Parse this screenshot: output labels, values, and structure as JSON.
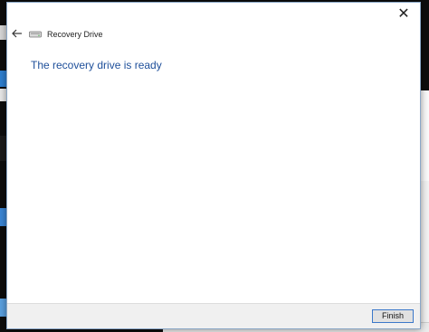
{
  "dialog": {
    "title": "Recovery Drive",
    "heading": "The recovery drive is ready",
    "close_label": "✕",
    "finish_label": "Finish"
  },
  "icons": {
    "back": "back-arrow-icon",
    "close": "close-icon",
    "drive": "drive-icon"
  },
  "colors": {
    "heading": "#1e4f9a",
    "button_border": "#3b78c9",
    "footer_bg": "#f0f0f0"
  }
}
